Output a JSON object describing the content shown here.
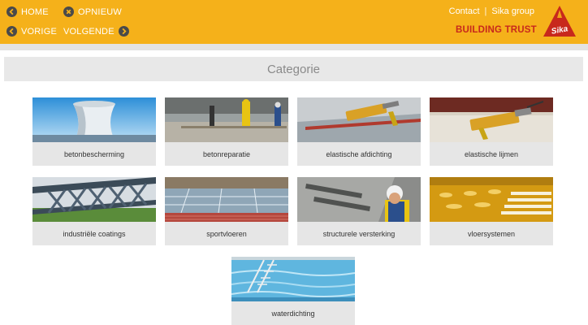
{
  "nav": {
    "home": "HOME",
    "restart": "OPNIEUW",
    "previous": "VORIGE",
    "next": "VOLGENDE"
  },
  "links": {
    "contact": "Contact",
    "separator": "|",
    "group": "Sika group"
  },
  "brand": {
    "tagline": "BUILDING TRUST",
    "logo_text": "Sika"
  },
  "page": {
    "title": "Categorie"
  },
  "categories": [
    {
      "label": "betonbescherming",
      "icon": "cooling-tower-photo"
    },
    {
      "label": "betonreparatie",
      "icon": "concrete-workers-photo"
    },
    {
      "label": "elastische afdichting",
      "icon": "sealant-gun-photo"
    },
    {
      "label": "elastische lijmen",
      "icon": "adhesive-gun-photo"
    },
    {
      "label": "industriële coatings",
      "icon": "steel-bridge-photo"
    },
    {
      "label": "sportvloeren",
      "icon": "sports-floor-photo"
    },
    {
      "label": "structurele versterking",
      "icon": "structural-worker-photo"
    },
    {
      "label": "vloersystemen",
      "icon": "floor-system-photo"
    },
    {
      "label": "waterdichting",
      "icon": "swimming-pool-photo"
    }
  ],
  "colors": {
    "header": "#f5b11a",
    "accent_red": "#c8281c",
    "tile_bg": "#e6e6e6"
  }
}
